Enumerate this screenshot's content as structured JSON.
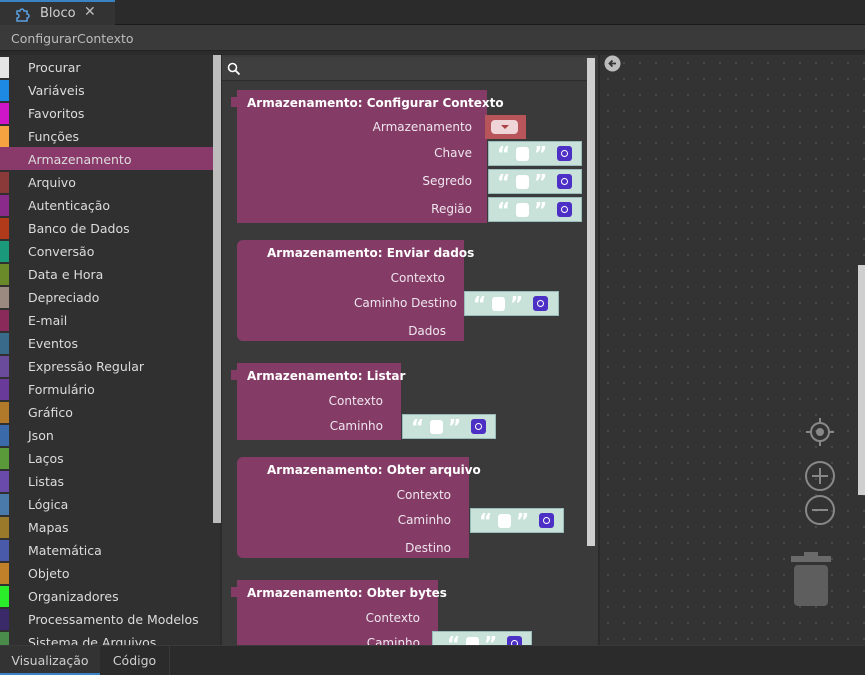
{
  "tab": {
    "title": "Bloco",
    "close": "✕"
  },
  "context_title": "ConfigurarContexto",
  "categories": [
    {
      "label": "Procurar",
      "color": "#e6e6e6"
    },
    {
      "label": "Variáveis",
      "color": "#1e88e5"
    },
    {
      "label": "Favoritos",
      "color": "#d014c8"
    },
    {
      "label": "Funções",
      "color": "#f4a340"
    },
    {
      "label": "Armazenamento",
      "color": "#8a3a6a"
    },
    {
      "label": "Arquivo",
      "color": "#8b3a3a"
    },
    {
      "label": "Autenticação",
      "color": "#8a2a8a"
    },
    {
      "label": "Banco de Dados",
      "color": "#b03a1a"
    },
    {
      "label": "Conversão",
      "color": "#1a9a7a"
    },
    {
      "label": "Data e Hora",
      "color": "#6a8a2a"
    },
    {
      "label": "Depreciado",
      "color": "#9a8a80"
    },
    {
      "label": "E-mail",
      "color": "#8a2a5a"
    },
    {
      "label": "Eventos",
      "color": "#3a6a8a"
    },
    {
      "label": "Expressão Regular",
      "color": "#6a4a9a"
    },
    {
      "label": "Formulário",
      "color": "#6a3a9a"
    },
    {
      "label": "Gráfico",
      "color": "#b07a2a"
    },
    {
      "label": "Json",
      "color": "#3a6aaa"
    },
    {
      "label": "Laços",
      "color": "#5a9a3a"
    },
    {
      "label": "Listas",
      "color": "#6a4aaa"
    },
    {
      "label": "Lógica",
      "color": "#4a7aaa"
    },
    {
      "label": "Mapas",
      "color": "#9a7a2a"
    },
    {
      "label": "Matemática",
      "color": "#4a5aaa"
    },
    {
      "label": "Objeto",
      "color": "#c0802a"
    },
    {
      "label": "Organizadores",
      "color": "#2aee2a"
    },
    {
      "label": "Processamento de Modelos",
      "color": "#3a2a6a"
    },
    {
      "label": "Sistema de Arquivos",
      "color": "#4a8a4a"
    }
  ],
  "selected_category": "Armazenamento",
  "blocks": {
    "b1": {
      "title": "Armazenamento: Configurar Contexto",
      "inputs": [
        "Armazenamento",
        "Chave",
        "Segredo",
        "Região"
      ]
    },
    "b2": {
      "title": "Armazenamento: Enviar dados",
      "inputs": [
        "Contexto",
        "Caminho Destino",
        "Dados"
      ]
    },
    "b3": {
      "title": "Armazenamento: Listar",
      "inputs": [
        "Contexto",
        "Caminho"
      ]
    },
    "b4": {
      "title": "Armazenamento: Obter arquivo",
      "inputs": [
        "Contexto",
        "Caminho",
        "Destino"
      ]
    },
    "b5": {
      "title": "Armazenamento: Obter bytes",
      "inputs": [
        "Contexto",
        "Caminho"
      ]
    }
  },
  "quote_open": "“",
  "quote_close": "”",
  "bottom_tabs": [
    "Visualização",
    "Código"
  ],
  "colors": {
    "block": "#843c67",
    "string": "#c9e2d9",
    "accent": "#3b82c4",
    "dropdown": "#b8555b"
  }
}
